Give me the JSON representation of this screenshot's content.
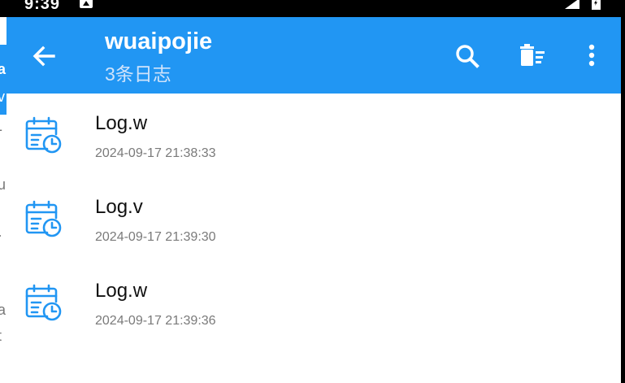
{
  "status_bar": {
    "time": "9:39"
  },
  "background_app": {
    "visible_chars": [
      "a",
      "v",
      "-",
      "u",
      "·",
      "a",
      "t"
    ]
  },
  "app_bar": {
    "title": "wuaipojie",
    "subtitle": "3条日志",
    "back_icon": "arrow-left-icon",
    "actions": [
      {
        "name": "search",
        "icon": "search-icon"
      },
      {
        "name": "clear-logs",
        "icon": "delete-list-icon"
      },
      {
        "name": "more",
        "icon": "more-vert-icon"
      }
    ]
  },
  "logs": [
    {
      "level": "Log.w",
      "timestamp": "2024-09-17 21:38:33",
      "icon": "calendar-clock-icon"
    },
    {
      "level": "Log.v",
      "timestamp": "2024-09-17 21:39:30",
      "icon": "calendar-clock-icon"
    },
    {
      "level": "Log.w",
      "timestamp": "2024-09-17 21:39:36",
      "icon": "calendar-clock-icon"
    }
  ],
  "colors": {
    "primary": "#2196f3",
    "appbar_text": "#ffffff",
    "subtitle_text": "#cfe3fb",
    "item_text": "#111111",
    "timestamp_text": "#7a7a7a",
    "background": "#ffffff"
  }
}
